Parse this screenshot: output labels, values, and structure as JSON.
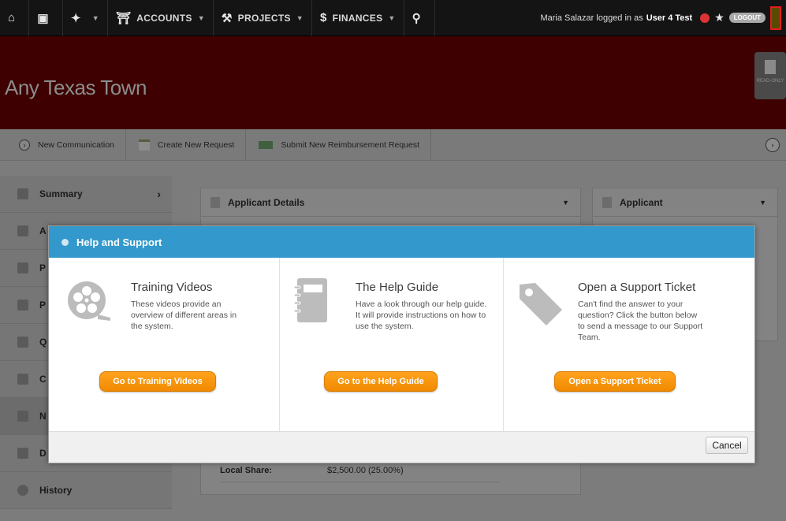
{
  "topnav": {
    "home_icon": "home-icon",
    "dashboard_icon": "dashboard-icon",
    "pin_icon": "pushpin-icon",
    "accounts_label": "ACCOUNTS",
    "projects_label": "PROJECTS",
    "finances_label": "FINANCES",
    "search_icon": "search-icon",
    "user_name": "Maria Salazar",
    "logged_in_text": "logged in as",
    "logged_in_user": "User 4 Test",
    "logout_label": "LOGOUT"
  },
  "banner": {
    "org_name": "Any Texas Town",
    "readonly_label": "READ-ONLY"
  },
  "actionbar": {
    "items": [
      {
        "label": "New Communication"
      },
      {
        "label": "Create New Request"
      },
      {
        "label": "Submit New Reimbursement Request"
      }
    ]
  },
  "sidebar": {
    "items": [
      {
        "label": "Summary"
      },
      {
        "label": "A"
      },
      {
        "label": "P"
      },
      {
        "label": "P"
      },
      {
        "label": "Q"
      },
      {
        "label": "C"
      },
      {
        "label": "N"
      },
      {
        "label": "D"
      },
      {
        "label": "History"
      }
    ]
  },
  "panels": {
    "main_title": "Applicant Details",
    "side_title": "Applicant",
    "local_share_label": "Local Share:",
    "local_share_value": "$2,500.00 (25.00%)"
  },
  "modal": {
    "title": "Help and Support",
    "columns": [
      {
        "icon": "film-reel-icon",
        "title": "Training Videos",
        "desc": "These videos provide an overview of different areas in the system.",
        "button": "Go to Training Videos"
      },
      {
        "icon": "notebook-icon",
        "title": "The Help Guide",
        "desc": "Have a look through our help guide. It will provide instructions on how to use the system.",
        "button": "Go to the Help Guide"
      },
      {
        "icon": "tag-icon",
        "title": "Open a Support Ticket",
        "desc": "Can't find the answer to your question? Click the button below to send a message to our Support Team.",
        "button": "Open a Support Ticket"
      }
    ],
    "cancel_label": "Cancel"
  },
  "colors": {
    "modal_header": "#3399cc",
    "button_orange": "#f7941d",
    "banner_red": "#3e0000"
  }
}
